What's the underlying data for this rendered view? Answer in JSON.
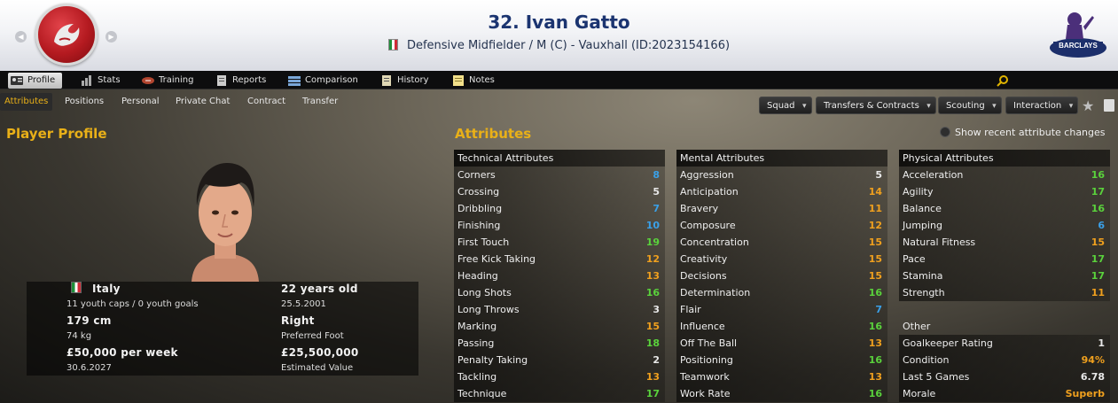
{
  "header": {
    "title": "32. Ivan Gatto",
    "subtitle": "Defensive Midfielder / M (C) - Vauxhall (ID:2023154166)"
  },
  "nav": {
    "items": [
      {
        "label": "Profile",
        "icon": "profile-icon"
      },
      {
        "label": "Stats",
        "icon": "stats-icon"
      },
      {
        "label": "Training",
        "icon": "training-icon"
      },
      {
        "label": "Reports",
        "icon": "reports-icon"
      },
      {
        "label": "Comparison",
        "icon": "comparison-icon"
      },
      {
        "label": "History",
        "icon": "history-icon"
      },
      {
        "label": "Notes",
        "icon": "notes-icon"
      }
    ]
  },
  "subnav": {
    "tabs": [
      "Attributes",
      "Positions",
      "Personal",
      "Private Chat",
      "Contract",
      "Transfer"
    ],
    "dropdowns": [
      "Squad",
      "Transfers & Contracts",
      "Scouting",
      "Interaction"
    ]
  },
  "profile": {
    "section_title": "Player Profile",
    "nationality": "Italy",
    "youth": "11 youth caps / 0 youth goals",
    "height": "179 cm",
    "weight": "74 kg",
    "wage": "£50,000 per week",
    "contract_end": "30.6.2027",
    "age": "22 years old",
    "dob": "25.5.2001",
    "foot": "Right",
    "foot_label": "Preferred Foot",
    "value": "£25,500,000",
    "value_label": "Estimated Value"
  },
  "attributes": {
    "section_title": "Attributes",
    "show_changes": "Show recent attribute changes",
    "technical": {
      "title": "Technical Attributes",
      "rows": [
        {
          "name": "Corners",
          "value": "8"
        },
        {
          "name": "Crossing",
          "value": "5"
        },
        {
          "name": "Dribbling",
          "value": "7"
        },
        {
          "name": "Finishing",
          "value": "10"
        },
        {
          "name": "First Touch",
          "value": "19"
        },
        {
          "name": "Free Kick Taking",
          "value": "12"
        },
        {
          "name": "Heading",
          "value": "13"
        },
        {
          "name": "Long Shots",
          "value": "16"
        },
        {
          "name": "Long Throws",
          "value": "3"
        },
        {
          "name": "Marking",
          "value": "15"
        },
        {
          "name": "Passing",
          "value": "18"
        },
        {
          "name": "Penalty Taking",
          "value": "2"
        },
        {
          "name": "Tackling",
          "value": "13"
        },
        {
          "name": "Technique",
          "value": "17"
        }
      ]
    },
    "mental": {
      "title": "Mental Attributes",
      "rows": [
        {
          "name": "Aggression",
          "value": "5"
        },
        {
          "name": "Anticipation",
          "value": "14"
        },
        {
          "name": "Bravery",
          "value": "11"
        },
        {
          "name": "Composure",
          "value": "12"
        },
        {
          "name": "Concentration",
          "value": "15"
        },
        {
          "name": "Creativity",
          "value": "15"
        },
        {
          "name": "Decisions",
          "value": "15"
        },
        {
          "name": "Determination",
          "value": "16"
        },
        {
          "name": "Flair",
          "value": "7"
        },
        {
          "name": "Influence",
          "value": "16"
        },
        {
          "name": "Off The Ball",
          "value": "13"
        },
        {
          "name": "Positioning",
          "value": "16"
        },
        {
          "name": "Teamwork",
          "value": "13"
        },
        {
          "name": "Work Rate",
          "value": "16"
        }
      ]
    },
    "physical": {
      "title": "Physical Attributes",
      "rows": [
        {
          "name": "Acceleration",
          "value": "16"
        },
        {
          "name": "Agility",
          "value": "17"
        },
        {
          "name": "Balance",
          "value": "16"
        },
        {
          "name": "Jumping",
          "value": "6"
        },
        {
          "name": "Natural Fitness",
          "value": "15"
        },
        {
          "name": "Pace",
          "value": "17"
        },
        {
          "name": "Stamina",
          "value": "17"
        },
        {
          "name": "Strength",
          "value": "11"
        }
      ]
    },
    "other": {
      "title": "Other",
      "rows": [
        {
          "name": "Goalkeeper Rating",
          "value": "1"
        },
        {
          "name": "Condition",
          "value": "94%"
        },
        {
          "name": "Last 5 Games",
          "value": "6.78"
        },
        {
          "name": "Morale",
          "value": "Superb"
        }
      ]
    }
  },
  "colors": {
    "low": "#e8e8e8",
    "blue": "#3aa0e8",
    "orange": "#f0a01e",
    "green": "#5ad23c",
    "accent": "#e9b018"
  }
}
